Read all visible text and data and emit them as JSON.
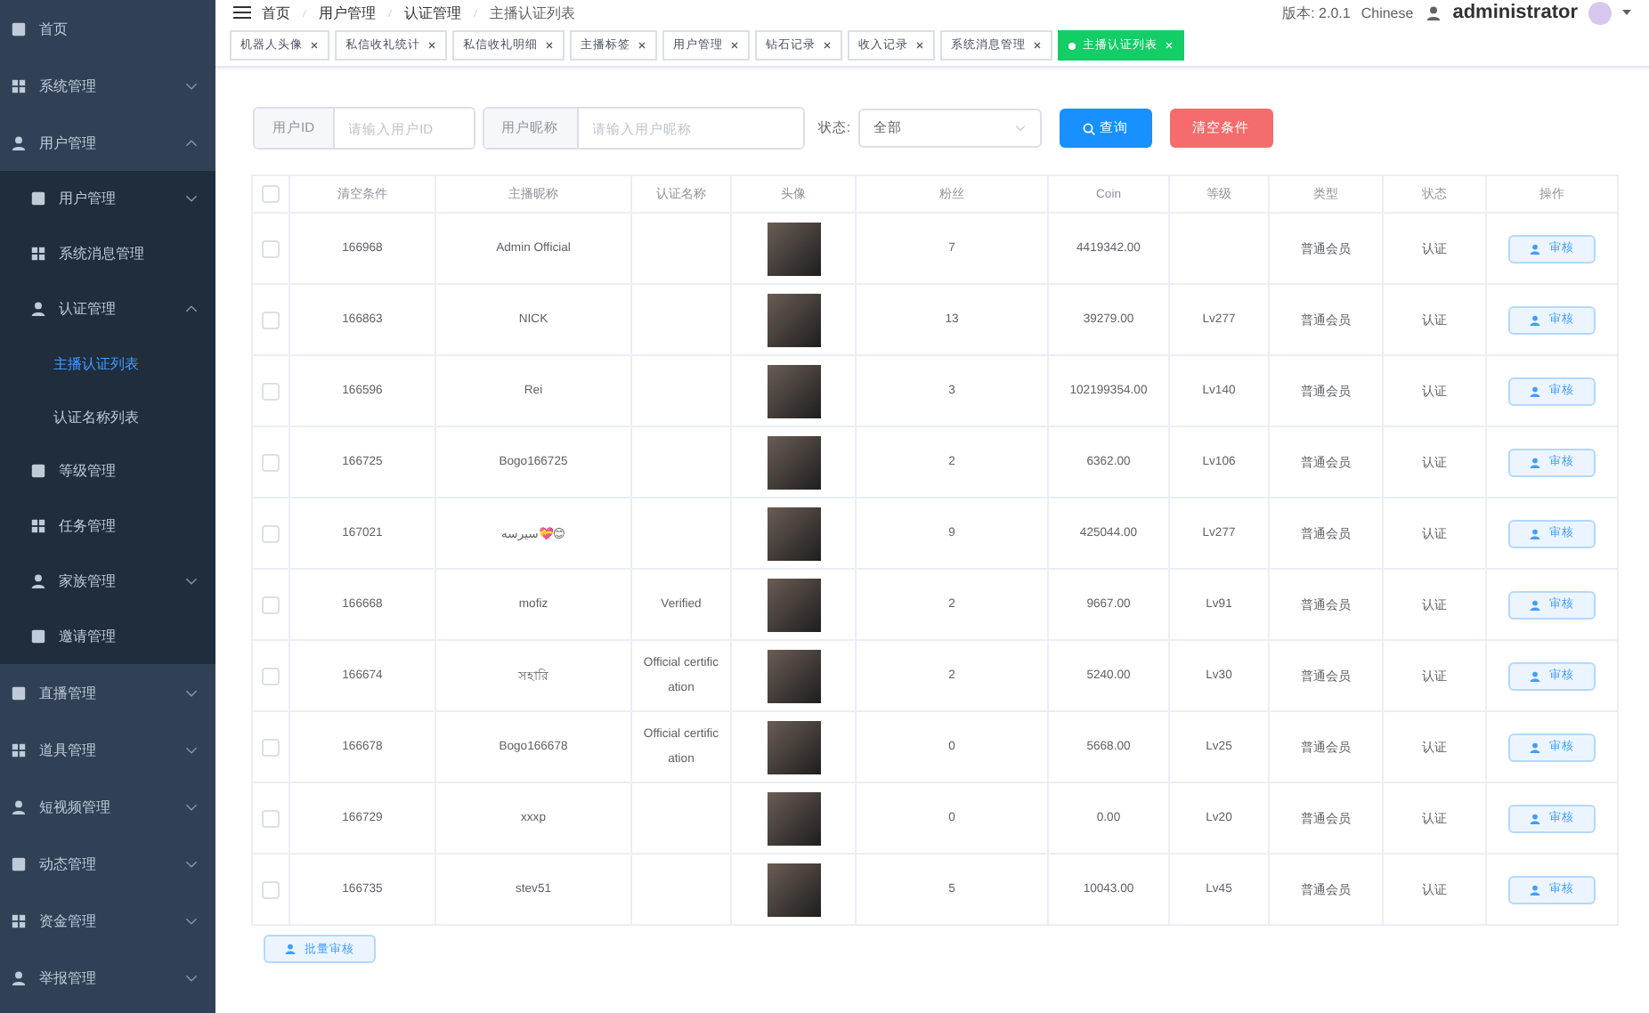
{
  "sidebar": {
    "items": [
      {
        "label": "首页",
        "kind": "link",
        "selected": false
      },
      {
        "label": "系统管理",
        "kind": "group",
        "expanded": false,
        "selected": false
      },
      {
        "label": "用户管理",
        "kind": "group",
        "expanded": true,
        "selected": false,
        "children": [
          {
            "label": "用户管理",
            "kind": "group",
            "expanded": false,
            "selected": false
          },
          {
            "label": "系统消息管理",
            "kind": "link",
            "selected": false
          },
          {
            "label": "认证管理",
            "kind": "group",
            "expanded": true,
            "selected": false,
            "children": [
              {
                "label": "主播认证列表",
                "kind": "link",
                "selected": true
              },
              {
                "label": "认证名称列表",
                "kind": "link",
                "selected": false
              }
            ]
          },
          {
            "label": "等级管理",
            "kind": "link",
            "selected": false
          },
          {
            "label": "任务管理",
            "kind": "link",
            "selected": false
          },
          {
            "label": "家族管理",
            "kind": "group",
            "expanded": false,
            "selected": false
          },
          {
            "label": "邀请管理",
            "kind": "link",
            "selected": false
          }
        ]
      },
      {
        "label": "直播管理",
        "kind": "group",
        "expanded": false,
        "selected": false
      },
      {
        "label": "道具管理",
        "kind": "group",
        "expanded": false,
        "selected": false
      },
      {
        "label": "短视频管理",
        "kind": "group",
        "expanded": false,
        "selected": false
      },
      {
        "label": "动态管理",
        "kind": "group",
        "expanded": false,
        "selected": false
      },
      {
        "label": "资金管理",
        "kind": "group",
        "expanded": false,
        "selected": false
      },
      {
        "label": "举报管理",
        "kind": "group",
        "expanded": false,
        "selected": false
      }
    ]
  },
  "header": {
    "breadcrumb": [
      "首页",
      "用户管理",
      "认证管理",
      "主播认证列表"
    ],
    "version": "版本: 2.0.1",
    "language": "Chinese",
    "user": "administrator"
  },
  "tags": [
    {
      "label": "机器人头像",
      "selected": false
    },
    {
      "label": "私信收礼统计",
      "selected": false
    },
    {
      "label": "私信收礼明细",
      "selected": false
    },
    {
      "label": "主播标签",
      "selected": false
    },
    {
      "label": "用户管理",
      "selected": false
    },
    {
      "label": "钻石记录",
      "selected": false
    },
    {
      "label": "收入记录",
      "selected": false
    },
    {
      "label": "系统消息管理",
      "selected": false
    },
    {
      "label": "主播认证列表",
      "selected": true
    }
  ],
  "filters": {
    "user_id": {
      "label": "用户ID",
      "placeholder": "请输入用户ID"
    },
    "nickname": {
      "label": "用户昵称",
      "placeholder": "请输入用户昵称"
    },
    "status": {
      "label": "状态:",
      "value": "全部"
    },
    "search_button": "查询",
    "clear_button": "清空条件"
  },
  "table": {
    "columns": [
      "清空条件",
      "主播昵称",
      "认证名称",
      "头像",
      "粉丝",
      "Coin",
      "等级",
      "类型",
      "状态",
      "操作"
    ],
    "header_checked": false,
    "rows": [
      {
        "checked": false,
        "id": "166968",
        "nickname": "Admin Official",
        "cert": "",
        "fans": "7",
        "coin": "4419342.00",
        "level": "",
        "type": "普通会员",
        "status": "认证",
        "action": "审核"
      },
      {
        "checked": false,
        "id": "166863",
        "nickname": "NICK",
        "cert": "",
        "fans": "13",
        "coin": "39279.00",
        "level": "Lv277",
        "type": "普通会员",
        "status": "认证",
        "action": "审核"
      },
      {
        "checked": false,
        "id": "166596",
        "nickname": "Rei",
        "cert": "",
        "fans": "3",
        "coin": "102199354.00",
        "level": "Lv140",
        "type": "普通会员",
        "status": "认证",
        "action": "审核"
      },
      {
        "checked": false,
        "id": "166725",
        "nickname": "Bogo166725",
        "cert": "",
        "fans": "2",
        "coin": "6362.00",
        "level": "Lv106",
        "type": "普通会员",
        "status": "认证",
        "action": "审核"
      },
      {
        "checked": false,
        "id": "167021",
        "nickname": "سيرسه💝😊",
        "cert": "",
        "fans": "9",
        "coin": "425044.00",
        "level": "Lv277",
        "type": "普通会员",
        "status": "认证",
        "action": "审核"
      },
      {
        "checked": false,
        "id": "166668",
        "nickname": "mofiz",
        "cert": "Verified",
        "fans": "2",
        "coin": "9667.00",
        "level": "Lv91",
        "type": "普通会员",
        "status": "认证",
        "action": "审核"
      },
      {
        "checked": false,
        "id": "166674",
        "nickname": "সহারি",
        "cert": "Official certification",
        "fans": "2",
        "coin": "5240.00",
        "level": "Lv30",
        "type": "普通会员",
        "status": "认证",
        "action": "审核"
      },
      {
        "checked": false,
        "id": "166678",
        "nickname": "Bogo166678",
        "cert": "Official certification",
        "fans": "0",
        "coin": "5668.00",
        "level": "Lv25",
        "type": "普通会员",
        "status": "认证",
        "action": "审核"
      },
      {
        "checked": false,
        "id": "166729",
        "nickname": "xxxp",
        "cert": "",
        "fans": "0",
        "coin": "0.00",
        "level": "Lv20",
        "type": "普通会员",
        "status": "认证",
        "action": "审核"
      },
      {
        "checked": false,
        "id": "166735",
        "nickname": "stev51",
        "cert": "",
        "fans": "5",
        "coin": "10043.00",
        "level": "Lv45",
        "type": "普通会员",
        "status": "认证",
        "action": "审核"
      }
    ]
  },
  "batch_button": "批量审核"
}
